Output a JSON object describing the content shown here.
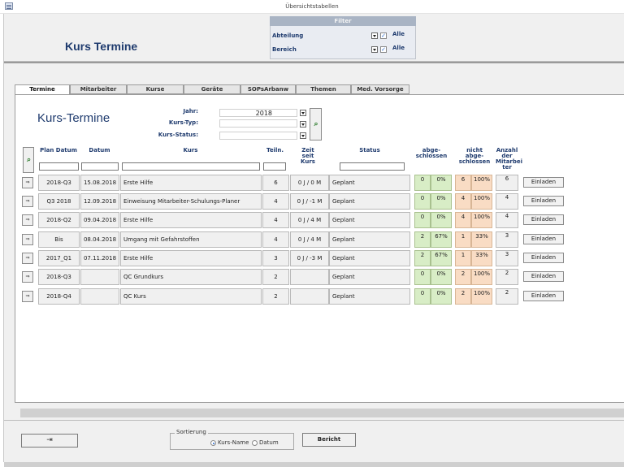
{
  "window": {
    "title": "Übersichtstabellen"
  },
  "header": {
    "title": "Kurs Termine"
  },
  "filter": {
    "title": "Filter",
    "rows": [
      {
        "label": "Abteilung",
        "check_label": "Alle",
        "checked": true
      },
      {
        "label": "Bereich",
        "check_label": "Alle",
        "checked": true
      }
    ]
  },
  "tabs": [
    {
      "label": "Termine",
      "active": true
    },
    {
      "label": "Mitarbeiter",
      "active": false
    },
    {
      "label": "Kurse",
      "active": false
    },
    {
      "label": "Geräte",
      "active": false
    },
    {
      "label": "SOPsArbanw",
      "active": false
    },
    {
      "label": "Themen",
      "active": false
    },
    {
      "label": "Med. Vorsorge",
      "active": false
    }
  ],
  "section": {
    "title": "Kurs-Termine",
    "selectors": [
      {
        "label": "Jahr:",
        "value": "2018"
      },
      {
        "label": "Kurs-Typ:",
        "value": ""
      },
      {
        "label": "Kurs-Status:",
        "value": ""
      }
    ]
  },
  "columns": {
    "plan_datum": "Plan Datum",
    "datum": "Datum",
    "kurs": "Kurs",
    "teiln": "Teiln.",
    "zeit_seit_kurs": "Zeit seit Kurs",
    "status": "Status",
    "abgeschlossen": "abge-schlossen",
    "nicht_abgeschlossen": "nicht abge-schlossen",
    "anzahl_mitarbeiter": "Anzahl der Mitarbei ter"
  },
  "rows": [
    {
      "plan": "2018-Q3",
      "datum": "15.08.2018",
      "kurs": "Erste Hilfe",
      "teiln": "6",
      "zeit": "0 J / 0 M",
      "status": "Geplant",
      "abg_n": "0",
      "abg_p": "0%",
      "nabg_n": "6",
      "nabg_p": "100%",
      "anzahl": "6",
      "button": "Einladen"
    },
    {
      "plan": "Q3 2018",
      "datum": "12.09.2018",
      "kurs": "Einweisung Mitarbeiter-Schulungs-Planer",
      "teiln": "4",
      "zeit": "0 J / -1 M",
      "status": "Geplant",
      "abg_n": "0",
      "abg_p": "0%",
      "nabg_n": "4",
      "nabg_p": "100%",
      "anzahl": "4",
      "button": "Einladen"
    },
    {
      "plan": "2018-Q2",
      "datum": "09.04.2018",
      "kurs": "Erste Hilfe",
      "teiln": "4",
      "zeit": "0 J / 4 M",
      "status": "Geplant",
      "abg_n": "0",
      "abg_p": "0%",
      "nabg_n": "4",
      "nabg_p": "100%",
      "anzahl": "4",
      "button": "Einladen"
    },
    {
      "plan": "Bis",
      "datum": "08.04.2018",
      "kurs": "Umgang mit Gefahrstoffen",
      "teiln": "4",
      "zeit": "0 J / 4 M",
      "status": "Geplant",
      "abg_n": "2",
      "abg_p": "67%",
      "nabg_n": "1",
      "nabg_p": "33%",
      "anzahl": "3",
      "button": "Einladen"
    },
    {
      "plan": "2017_Q1",
      "datum": "07.11.2018",
      "kurs": "Erste Hilfe",
      "teiln": "3",
      "zeit": "0 J / -3 M",
      "status": "Geplant",
      "abg_n": "2",
      "abg_p": "67%",
      "nabg_n": "1",
      "nabg_p": "33%",
      "anzahl": "3",
      "button": "Einladen"
    },
    {
      "plan": "2018-Q3",
      "datum": "",
      "kurs": "QC Grundkurs",
      "teiln": "2",
      "zeit": "",
      "status": "Geplant",
      "abg_n": "0",
      "abg_p": "0%",
      "nabg_n": "2",
      "nabg_p": "100%",
      "anzahl": "2",
      "button": "Einladen"
    },
    {
      "plan": "2018-Q4",
      "datum": "",
      "kurs": "QC Kurs",
      "teiln": "2",
      "zeit": "",
      "status": "Geplant",
      "abg_n": "0",
      "abg_p": "0%",
      "nabg_n": "2",
      "nabg_p": "100%",
      "anzahl": "2",
      "button": "Einladen"
    }
  ],
  "footer": {
    "sort_label": "Sortierung",
    "sort_options": [
      {
        "label": "Kurs-Name",
        "selected": true
      },
      {
        "label": "Datum",
        "selected": false
      }
    ],
    "report_label": "Bericht"
  },
  "icons": {
    "app": "table-icon",
    "exit": "exit-door-icon",
    "search": "binoculars-search-icon",
    "row_open": "arrow-right-icon"
  },
  "colors": {
    "title_blue": "#1f3b6e",
    "done_green": "#d8edc6",
    "open_orange": "#f9dcc4"
  }
}
